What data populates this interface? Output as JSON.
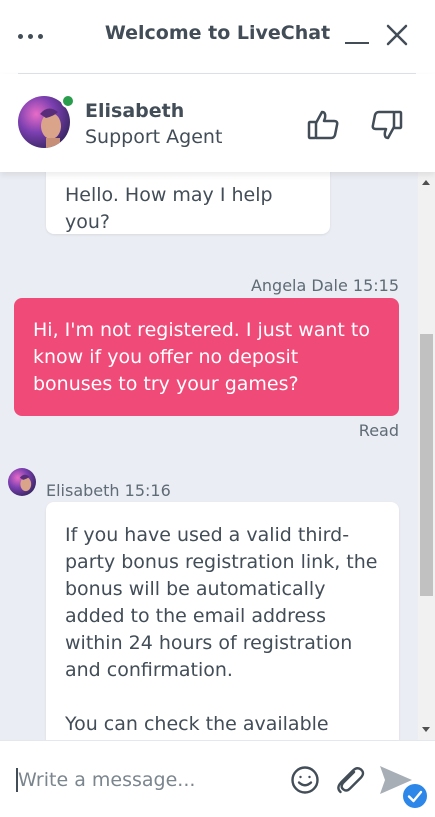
{
  "header": {
    "title": "Welcome to LiveChat",
    "menu_icon": "more-horizontal-icon",
    "minimize_icon": "minimize-icon",
    "close_icon": "close-icon"
  },
  "agent": {
    "name": "Elisabeth",
    "role": "Support Agent",
    "status": "online",
    "status_color": "#2a9d4d",
    "rate_good_icon": "thumbs-up-icon",
    "rate_bad_icon": "thumbs-down-icon"
  },
  "messages": [
    {
      "from": "agent",
      "text": "Hello. How may I help you?"
    },
    {
      "from": "visitor",
      "author_time": "Angela Dale 15:15",
      "text": "Hi, I'm not registered. I just want to know if you offer no deposit bonuses to try your games?",
      "status": "Read"
    },
    {
      "from": "agent",
      "author_time": "Elisabeth 15:16",
      "paragraphs": [
        "If you have used a valid third-party bonus registration link, the bonus will be automatically added to the email address within 24 hours of registration and confirmation.",
        "You can check the available casino offers on this page -"
      ]
    }
  ],
  "composer": {
    "placeholder": "Write a message...",
    "value": "",
    "emoji_icon": "emoji-icon",
    "attach_icon": "paperclip-icon",
    "send_icon": "send-icon"
  },
  "colors": {
    "visitor_bubble": "#f04b78",
    "chat_background": "#eaedf3",
    "accent_blue": "#2c87e8"
  }
}
